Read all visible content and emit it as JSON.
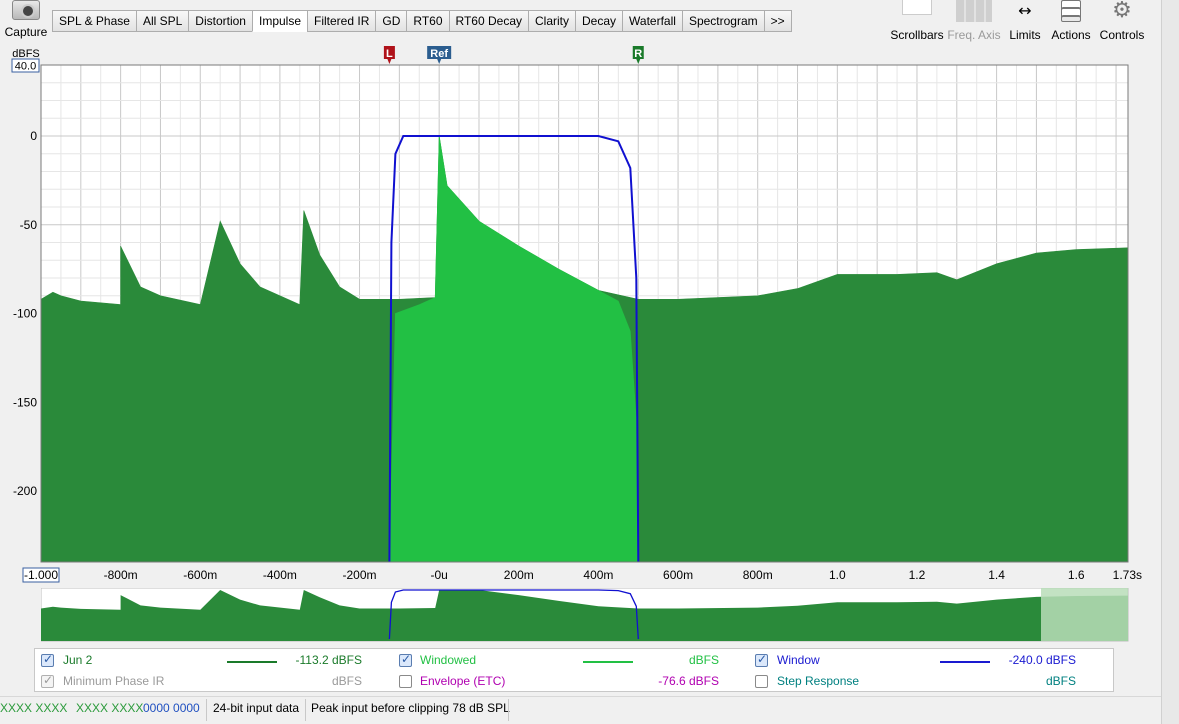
{
  "toolbar": {
    "capture_label": "Capture",
    "tabs": [
      "SPL & Phase",
      "All SPL",
      "Distortion",
      "Impulse",
      "Filtered IR",
      "GD",
      "RT60",
      "RT60 Decay",
      "Clarity",
      "Decay",
      "Waterfall",
      "Spectrogram",
      ">>"
    ],
    "active_tab": "Impulse",
    "right_tools": {
      "scrollbars": "Scrollbars",
      "freq_axis": "Freq. Axis",
      "limits": "Limits",
      "actions": "Actions",
      "controls": "Controls"
    }
  },
  "chart_data": {
    "type": "area",
    "ylabel": "dBFS",
    "y_top_box": "40.0",
    "x_left_box": "-1.000",
    "x_right_label": "1.73s",
    "ylim": [
      -240,
      40
    ],
    "xlim": [
      -1.0,
      1.73
    ],
    "y_ticks": [
      {
        "v": 0,
        "label": "0"
      },
      {
        "v": -50,
        "label": "-50"
      },
      {
        "v": -100,
        "label": "-100"
      },
      {
        "v": -150,
        "label": "-150"
      },
      {
        "v": -200,
        "label": "-200"
      }
    ],
    "x_ticks": [
      {
        "v": -0.8,
        "label": "-800m"
      },
      {
        "v": -0.6,
        "label": "-600m"
      },
      {
        "v": -0.4,
        "label": "-400m"
      },
      {
        "v": -0.2,
        "label": "-200m"
      },
      {
        "v": 0.0,
        "label": "-0u"
      },
      {
        "v": 0.2,
        "label": "200m"
      },
      {
        "v": 0.4,
        "label": "400m"
      },
      {
        "v": 0.6,
        "label": "600m"
      },
      {
        "v": 0.8,
        "label": "800m"
      },
      {
        "v": 1.0,
        "label": "1.0"
      },
      {
        "v": 1.2,
        "label": "1.2"
      },
      {
        "v": 1.4,
        "label": "1.4"
      },
      {
        "v": 1.6,
        "label": "1.6"
      }
    ],
    "markers": [
      {
        "label": "L",
        "x": -0.125,
        "color": "#b0121a"
      },
      {
        "label": "Ref",
        "x": 0.0,
        "color": "#2b5d8f"
      },
      {
        "label": "R",
        "x": 0.5,
        "color": "#1a7a2a"
      }
    ],
    "grid": true,
    "series": [
      {
        "name": "Jun 2",
        "color": "#2a8a3a",
        "points": [
          [
            -1.0,
            -92
          ],
          [
            -0.97,
            -88
          ],
          [
            -0.95,
            -90
          ],
          [
            -0.9,
            -93
          ],
          [
            -0.8,
            -95
          ],
          [
            -0.8,
            -62
          ],
          [
            -0.75,
            -85
          ],
          [
            -0.7,
            -90
          ],
          [
            -0.6,
            -95
          ],
          [
            -0.55,
            -48
          ],
          [
            -0.5,
            -72
          ],
          [
            -0.45,
            -85
          ],
          [
            -0.35,
            -95
          ],
          [
            -0.34,
            -42
          ],
          [
            -0.3,
            -67
          ],
          [
            -0.25,
            -85
          ],
          [
            -0.2,
            -92
          ],
          [
            -0.1,
            -92
          ],
          [
            -0.01,
            -91
          ],
          [
            0.0,
            0
          ],
          [
            0.02,
            -28
          ],
          [
            0.1,
            -48
          ],
          [
            0.2,
            -62
          ],
          [
            0.3,
            -75
          ],
          [
            0.4,
            -87
          ],
          [
            0.5,
            -92
          ],
          [
            0.6,
            -92
          ],
          [
            0.8,
            -90
          ],
          [
            0.9,
            -86
          ],
          [
            1.0,
            -78
          ],
          [
            1.15,
            -78
          ],
          [
            1.25,
            -77
          ],
          [
            1.3,
            -81
          ],
          [
            1.4,
            -72
          ],
          [
            1.5,
            -66
          ],
          [
            1.6,
            -64
          ],
          [
            1.73,
            -63
          ]
        ]
      },
      {
        "name": "Windowed",
        "color": "#22c044",
        "points": [
          [
            -0.125,
            -240
          ],
          [
            -0.11,
            -100
          ],
          [
            -0.05,
            -95
          ],
          [
            -0.01,
            -91
          ],
          [
            0.0,
            0
          ],
          [
            0.02,
            -28
          ],
          [
            0.1,
            -48
          ],
          [
            0.2,
            -62
          ],
          [
            0.3,
            -75
          ],
          [
            0.4,
            -87
          ],
          [
            0.45,
            -93
          ],
          [
            0.48,
            -110
          ],
          [
            0.495,
            -160
          ],
          [
            0.5,
            -240
          ]
        ]
      }
    ],
    "window": {
      "name": "Window",
      "color": "#1010d0",
      "points": [
        [
          -0.125,
          -240
        ],
        [
          -0.12,
          -60
        ],
        [
          -0.11,
          -10
        ],
        [
          -0.09,
          0
        ],
        [
          0.4,
          0
        ],
        [
          0.45,
          -3
        ],
        [
          0.48,
          -18
        ],
        [
          0.495,
          -80
        ],
        [
          0.5,
          -240
        ]
      ]
    }
  },
  "overview": {
    "highlight_color": "#b9ddb9"
  },
  "legend": {
    "rows": [
      [
        {
          "checked": true,
          "label": "Jun 2",
          "color": "#1a7a2a",
          "value": "-113.2 dBFS",
          "value_color": "#1a7a2a"
        },
        {
          "checked": true,
          "label": "Windowed",
          "color": "#22c044",
          "value": "dBFS",
          "value_color": "#22c044"
        },
        {
          "checked": true,
          "label": "Window",
          "color": "#1a1ad0",
          "value": "-240.0 dBFS",
          "value_color": "#1a1ad0"
        }
      ],
      [
        {
          "checked": true,
          "label": "Minimum Phase IR",
          "color": "#9a9a9a",
          "value": "dBFS",
          "value_color": "#9a9a9a",
          "disabled": true
        },
        {
          "checked": false,
          "label": "Envelope (ETC)",
          "color": "#b000b0",
          "value": "-76.6 dBFS",
          "value_color": "#b000b0"
        },
        {
          "checked": false,
          "label": "Step Response",
          "color": "#008080",
          "value": "dBFS",
          "value_color": "#008080"
        }
      ]
    ]
  },
  "status": {
    "meter_left": "XXXX XXXX",
    "meter_right": "XXXX XXXX",
    "meter_blue": "0000 0000",
    "input_bits": "24-bit input data",
    "peak": "Peak input before clipping 78 dB SPL"
  }
}
